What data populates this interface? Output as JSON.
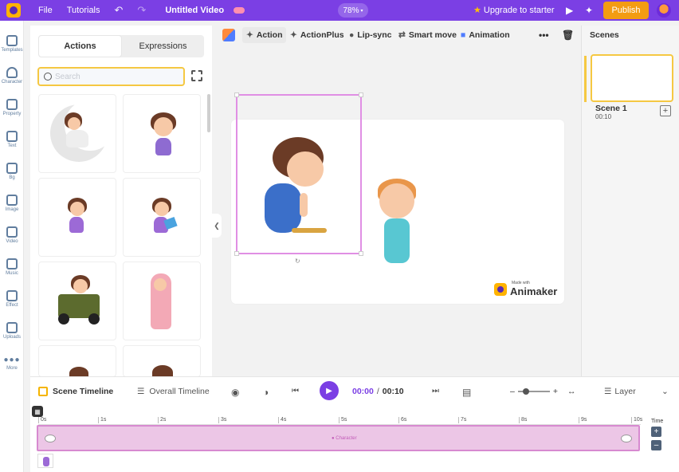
{
  "topbar": {
    "file_label": "File",
    "tutorials_label": "Tutorials",
    "project_title": "Untitled Video",
    "zoom": "78%",
    "upgrade_label": "Upgrade to starter",
    "publish_label": "Publish",
    "accent_color": "#7b3fe4",
    "publish_color": "#f39c12"
  },
  "sidebar": {
    "items": [
      {
        "label": "Templates",
        "icon": "templates-icon"
      },
      {
        "label": "Character",
        "icon": "character-icon"
      },
      {
        "label": "Property",
        "icon": "property-icon"
      },
      {
        "label": "Text",
        "icon": "text-icon"
      },
      {
        "label": "Bg",
        "icon": "bg-icon"
      },
      {
        "label": "Image",
        "icon": "image-icon"
      },
      {
        "label": "Video",
        "icon": "video-icon"
      },
      {
        "label": "Music",
        "icon": "music-icon"
      },
      {
        "label": "Effect",
        "icon": "effect-icon"
      },
      {
        "label": "Uploads",
        "icon": "uploads-icon"
      },
      {
        "label": "More",
        "icon": "more-icon"
      }
    ]
  },
  "library": {
    "tabs": [
      {
        "label": "Actions",
        "active": true
      },
      {
        "label": "Expressions",
        "active": false
      }
    ],
    "search_placeholder": "Search",
    "search_value": ""
  },
  "toolbar": {
    "items": [
      {
        "label": "Action",
        "active": true
      },
      {
        "label": "ActionPlus"
      },
      {
        "label": "Lip-sync"
      },
      {
        "label": "Smart move"
      },
      {
        "label": "Animation"
      }
    ],
    "more_icon": "more-icon",
    "delete_icon": "trash-icon"
  },
  "canvas": {
    "watermark_small": "Made with",
    "watermark_brand": "Animaker"
  },
  "scenes": {
    "title": "Scenes",
    "items": [
      {
        "name": "Scene 1",
        "duration": "00:10"
      }
    ]
  },
  "timeline": {
    "scene_timeline_label": "Scene Timeline",
    "overall_timeline_label": "Overall Timeline",
    "current_time": "00:00",
    "separator": "/",
    "total_time": "00:10",
    "layer_label": "Layer",
    "ticks": [
      "0s",
      "1s",
      "2s",
      "3s",
      "4s",
      "5s",
      "6s",
      "7s",
      "8s",
      "9s",
      "10s"
    ],
    "time_label": "Time",
    "track_label": "Character"
  }
}
